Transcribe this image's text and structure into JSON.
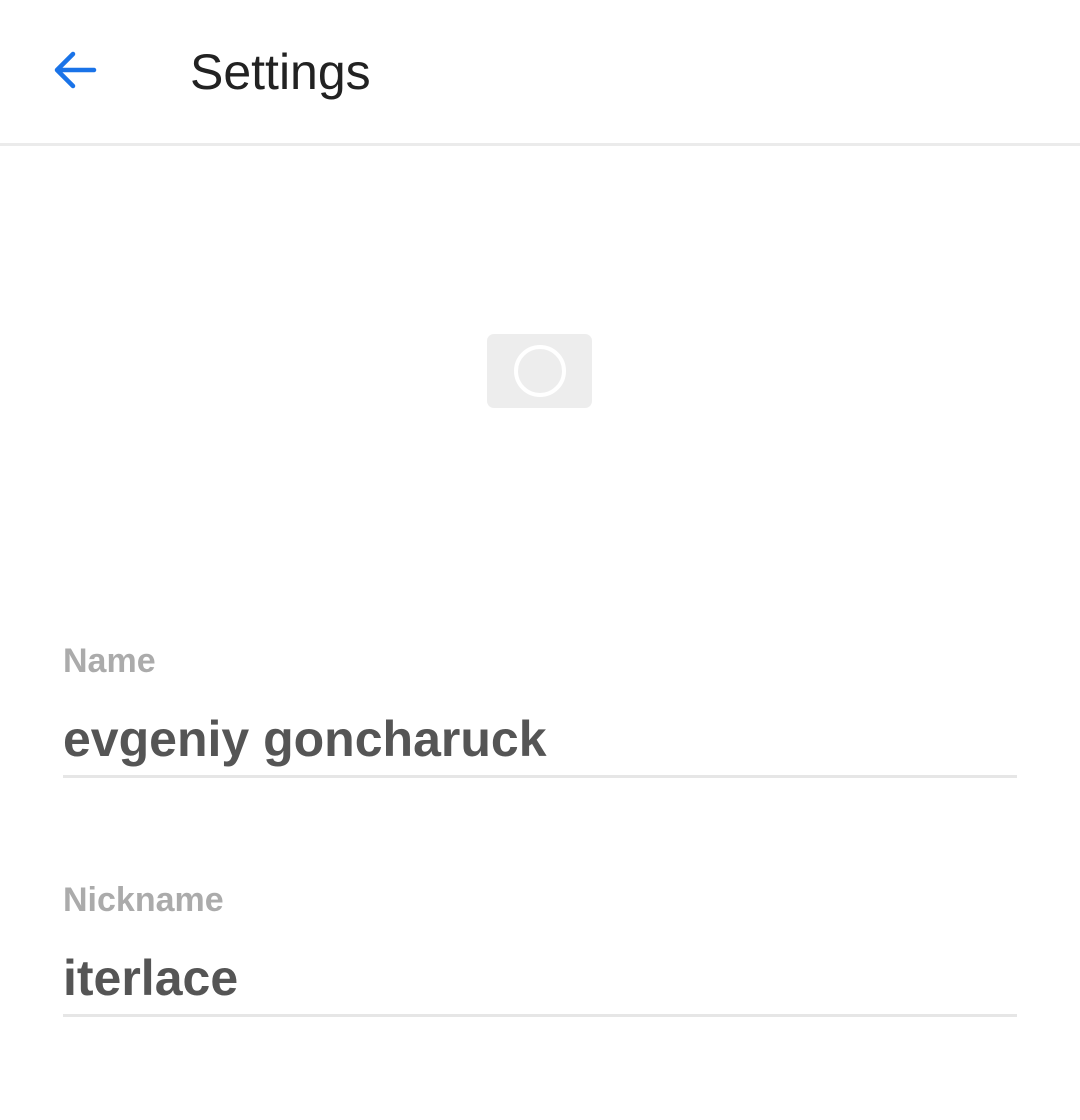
{
  "header": {
    "title": "Settings",
    "back_icon": "arrow-left-icon",
    "accent_color": "#1a73e8"
  },
  "profile": {
    "avatar_icon": "avatar-placeholder-icon"
  },
  "fields": {
    "name": {
      "label": "Name",
      "value": "evgeniy goncharuck"
    },
    "nickname": {
      "label": "Nickname",
      "value": "iterlace"
    }
  }
}
